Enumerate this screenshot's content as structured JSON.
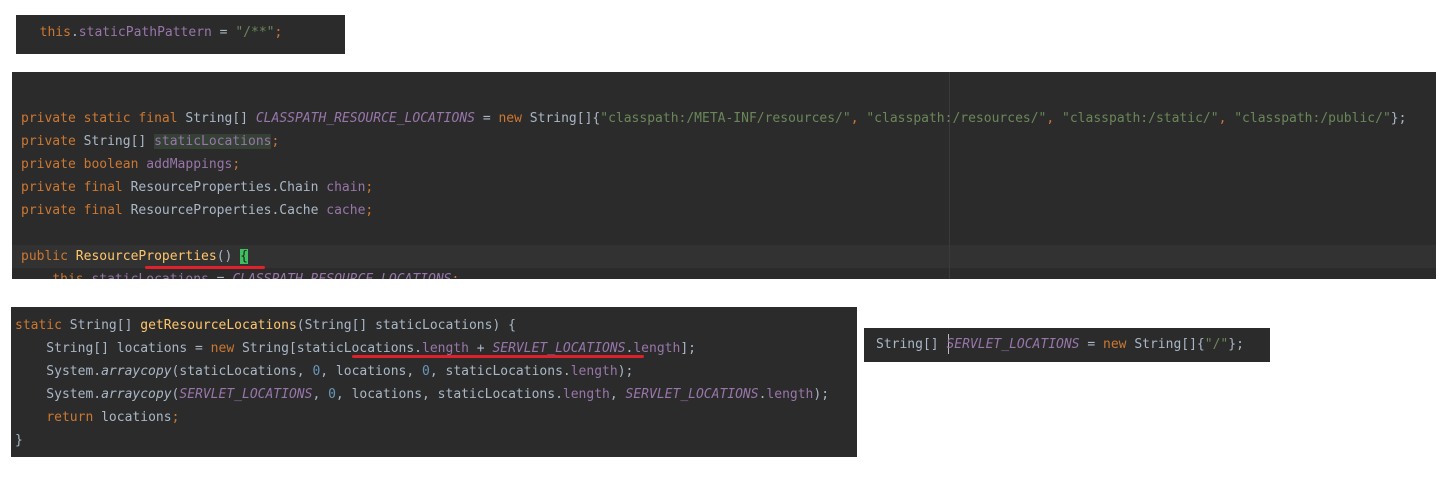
{
  "colors": {
    "background": "#2b2b2b",
    "text": "#a9b7c6",
    "keyword": "#cc7832",
    "string": "#6a8759",
    "field": "#9876aa",
    "method_decl": "#ffc66d",
    "number": "#6897bb",
    "current_line": "#323232",
    "usage_highlight": "#344134",
    "brace_match": "#3fbf5f",
    "underline": "#e0202a"
  },
  "snippet_top": {
    "lines": [
      [
        {
          "t": "  ",
          "c": "plain"
        },
        {
          "t": "this",
          "c": "kw"
        },
        {
          "t": ".",
          "c": "plain"
        },
        {
          "t": "staticPathPattern",
          "c": "field"
        },
        {
          "t": " = ",
          "c": "plain"
        },
        {
          "t": "\"/**\"",
          "c": "str"
        },
        {
          "t": ";",
          "c": "kw"
        }
      ]
    ]
  },
  "snippet_resource_properties": {
    "lines": [
      [
        {
          "t": "private ",
          "c": "kw"
        },
        {
          "t": "static ",
          "c": "kw"
        },
        {
          "t": "final ",
          "c": "kw"
        },
        {
          "t": "String[] ",
          "c": "plain"
        },
        {
          "t": "CLASSPATH_RESOURCE_LOCATIONS",
          "c": "const"
        },
        {
          "t": " = ",
          "c": "plain"
        },
        {
          "t": "new ",
          "c": "kw"
        },
        {
          "t": "String[]{",
          "c": "plain"
        },
        {
          "t": "\"classpath:/META-INF/resources/\"",
          "c": "str"
        },
        {
          "t": ", ",
          "c": "kw"
        },
        {
          "t": "\"classpath:/resources/\"",
          "c": "str"
        },
        {
          "t": ", ",
          "c": "kw"
        },
        {
          "t": "\"classpath:/static/\"",
          "c": "str"
        },
        {
          "t": ", ",
          "c": "kw"
        },
        {
          "t": "\"classpath:/public/\"",
          "c": "str"
        },
        {
          "t": "};",
          "c": "plain"
        }
      ],
      [
        {
          "t": "private ",
          "c": "kw"
        },
        {
          "t": "String[] ",
          "c": "plain"
        },
        {
          "t": "staticLocations",
          "c": "field-usage"
        },
        {
          "t": ";",
          "c": "kw"
        }
      ],
      [
        {
          "t": "private ",
          "c": "kw"
        },
        {
          "t": "boolean ",
          "c": "kw"
        },
        {
          "t": "addMappings",
          "c": "field"
        },
        {
          "t": ";",
          "c": "kw"
        }
      ],
      [
        {
          "t": "private ",
          "c": "kw"
        },
        {
          "t": "final ",
          "c": "kw"
        },
        {
          "t": "ResourceProperties.Chain ",
          "c": "plain"
        },
        {
          "t": "chain",
          "c": "field"
        },
        {
          "t": ";",
          "c": "kw"
        }
      ],
      [
        {
          "t": "private ",
          "c": "kw"
        },
        {
          "t": "final ",
          "c": "kw"
        },
        {
          "t": "ResourceProperties.Cache ",
          "c": "plain"
        },
        {
          "t": "cache",
          "c": "field"
        },
        {
          "t": ";",
          "c": "kw"
        }
      ],
      [],
      [
        {
          "t": "public ",
          "c": "kw"
        },
        {
          "t": "ResourceProperties",
          "c": "method"
        },
        {
          "t": "() ",
          "c": "plain"
        },
        {
          "t": "{",
          "c": "brace"
        }
      ],
      [
        {
          "t": "    ",
          "c": "plain"
        },
        {
          "t": "this",
          "c": "kw"
        },
        {
          "t": ".",
          "c": "plain"
        },
        {
          "t": "staticLocations",
          "c": "field"
        },
        {
          "t": " = ",
          "c": "plain"
        },
        {
          "t": "CLASSPATH_RESOURCE_LOCATIONS",
          "c": "const"
        },
        {
          "t": ";",
          "c": "kw"
        }
      ]
    ]
  },
  "snippet_get_resource_locations": {
    "lines": [
      [
        {
          "t": "static ",
          "c": "kw"
        },
        {
          "t": "String[] ",
          "c": "plain"
        },
        {
          "t": "getResourceLocations",
          "c": "method"
        },
        {
          "t": "(String[] staticLocations) {",
          "c": "plain"
        }
      ],
      [
        {
          "t": "    String[] locations = ",
          "c": "plain"
        },
        {
          "t": "new ",
          "c": "kw"
        },
        {
          "t": "String[staticLocations.",
          "c": "plain"
        },
        {
          "t": "length",
          "c": "field"
        },
        {
          "t": " + ",
          "c": "plain"
        },
        {
          "t": "SERVLET_LOCATIONS",
          "c": "const"
        },
        {
          "t": ".",
          "c": "plain"
        },
        {
          "t": "length",
          "c": "field"
        },
        {
          "t": "];",
          "c": "plain"
        }
      ],
      [
        {
          "t": "    System.",
          "c": "plain"
        },
        {
          "t": "arraycopy",
          "c": "static-call"
        },
        {
          "t": "(staticLocations, ",
          "c": "plain"
        },
        {
          "t": "0",
          "c": "num"
        },
        {
          "t": ", locations, ",
          "c": "plain"
        },
        {
          "t": "0",
          "c": "num"
        },
        {
          "t": ", staticLocations.",
          "c": "plain"
        },
        {
          "t": "length",
          "c": "field"
        },
        {
          "t": ");",
          "c": "plain"
        }
      ],
      [
        {
          "t": "    System.",
          "c": "plain"
        },
        {
          "t": "arraycopy",
          "c": "static-call"
        },
        {
          "t": "(",
          "c": "plain"
        },
        {
          "t": "SERVLET_LOCATIONS",
          "c": "const"
        },
        {
          "t": ", ",
          "c": "plain"
        },
        {
          "t": "0",
          "c": "num"
        },
        {
          "t": ", locations, staticLocations.",
          "c": "plain"
        },
        {
          "t": "length",
          "c": "field"
        },
        {
          "t": ", ",
          "c": "plain"
        },
        {
          "t": "SERVLET_LOCATIONS",
          "c": "const"
        },
        {
          "t": ".",
          "c": "plain"
        },
        {
          "t": "length",
          "c": "field"
        },
        {
          "t": ");",
          "c": "plain"
        }
      ],
      [
        {
          "t": "    ",
          "c": "plain"
        },
        {
          "t": "return ",
          "c": "kw"
        },
        {
          "t": "locations",
          "c": "plain"
        },
        {
          "t": ";",
          "c": "kw"
        }
      ],
      [
        {
          "t": "}",
          "c": "plain"
        }
      ]
    ]
  },
  "snippet_servlet_locations": {
    "lines": [
      [
        {
          "t": "String[] ",
          "c": "plain"
        },
        {
          "t": "SERVLET_LOCATIONS",
          "c": "const"
        },
        {
          "t": " = ",
          "c": "plain"
        },
        {
          "t": "new ",
          "c": "kw"
        },
        {
          "t": "String[]{",
          "c": "plain"
        },
        {
          "t": "\"/\"",
          "c": "str"
        },
        {
          "t": "};",
          "c": "plain"
        }
      ]
    ]
  }
}
